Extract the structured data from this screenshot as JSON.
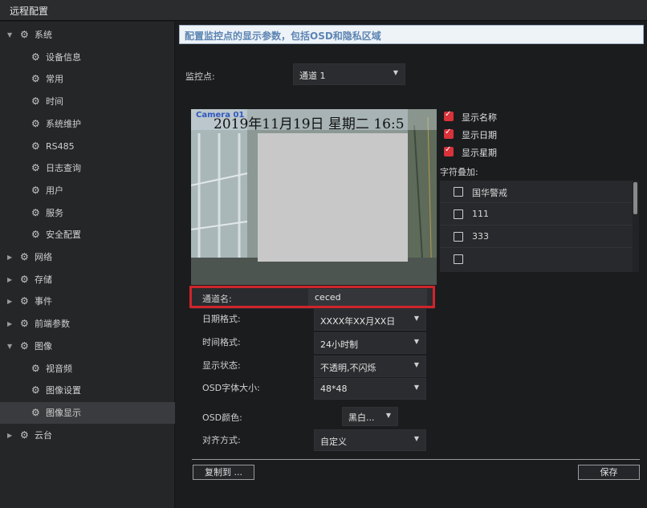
{
  "window": {
    "title": "远程配置"
  },
  "sidebar": {
    "items": [
      {
        "label": "系统",
        "level": 0,
        "expanded": true
      },
      {
        "label": "设备信息",
        "level": 1
      },
      {
        "label": "常用",
        "level": 1
      },
      {
        "label": "时间",
        "level": 1
      },
      {
        "label": "系统维护",
        "level": 1
      },
      {
        "label": "RS485",
        "level": 1
      },
      {
        "label": "日志查询",
        "level": 1
      },
      {
        "label": "用户",
        "level": 1
      },
      {
        "label": "服务",
        "level": 1
      },
      {
        "label": "安全配置",
        "level": 1
      },
      {
        "label": "网络",
        "level": 0,
        "expanded": false
      },
      {
        "label": "存储",
        "level": 0,
        "expanded": false
      },
      {
        "label": "事件",
        "level": 0,
        "expanded": false
      },
      {
        "label": "前端参数",
        "level": 0,
        "expanded": false
      },
      {
        "label": "图像",
        "level": 0,
        "expanded": true
      },
      {
        "label": "视音频",
        "level": 1
      },
      {
        "label": "图像设置",
        "level": 1
      },
      {
        "label": "图像显示",
        "level": 1,
        "selected": true
      },
      {
        "label": "云台",
        "level": 0,
        "expanded": false
      }
    ]
  },
  "banner": {
    "text": "配置监控点的显示参数，包括OSD和隐私区域"
  },
  "monitor": {
    "label": "监控点:",
    "value": "通道 1"
  },
  "preview": {
    "osd_text": "2019年11月19日 星期二 16:5",
    "channel_overlay": "Camera 01"
  },
  "checks": [
    {
      "label": "显示名称",
      "checked": true
    },
    {
      "label": "显示日期",
      "checked": true
    },
    {
      "label": "显示星期",
      "checked": true
    }
  ],
  "overlay": {
    "label": "字符叠加:",
    "items": [
      {
        "text": "国华警戒",
        "checked": false
      },
      {
        "text": "111",
        "checked": false
      },
      {
        "text": "333",
        "checked": false
      },
      {
        "text": "",
        "checked": false
      }
    ]
  },
  "form": {
    "channel_name": {
      "label": "通道名:",
      "value": "ceced"
    },
    "date_format": {
      "label": "日期格式:",
      "value": "XXXX年XX月XX日"
    },
    "time_format": {
      "label": "时间格式:",
      "value": "24小时制"
    },
    "display_state": {
      "label": "显示状态:",
      "value": "不透明,不闪烁"
    },
    "font_size": {
      "label": "OSD字体大小:",
      "value": "48*48"
    },
    "color": {
      "label": "OSD颜色:",
      "value": "黑白..."
    },
    "align": {
      "label": "对齐方式:",
      "value": "自定义"
    }
  },
  "buttons": {
    "copy": "复制到 ...",
    "save": "保存"
  },
  "colors": {
    "accent": "#d0242b",
    "banner_text": "#5d85b2",
    "background": "#1b1c1e"
  }
}
